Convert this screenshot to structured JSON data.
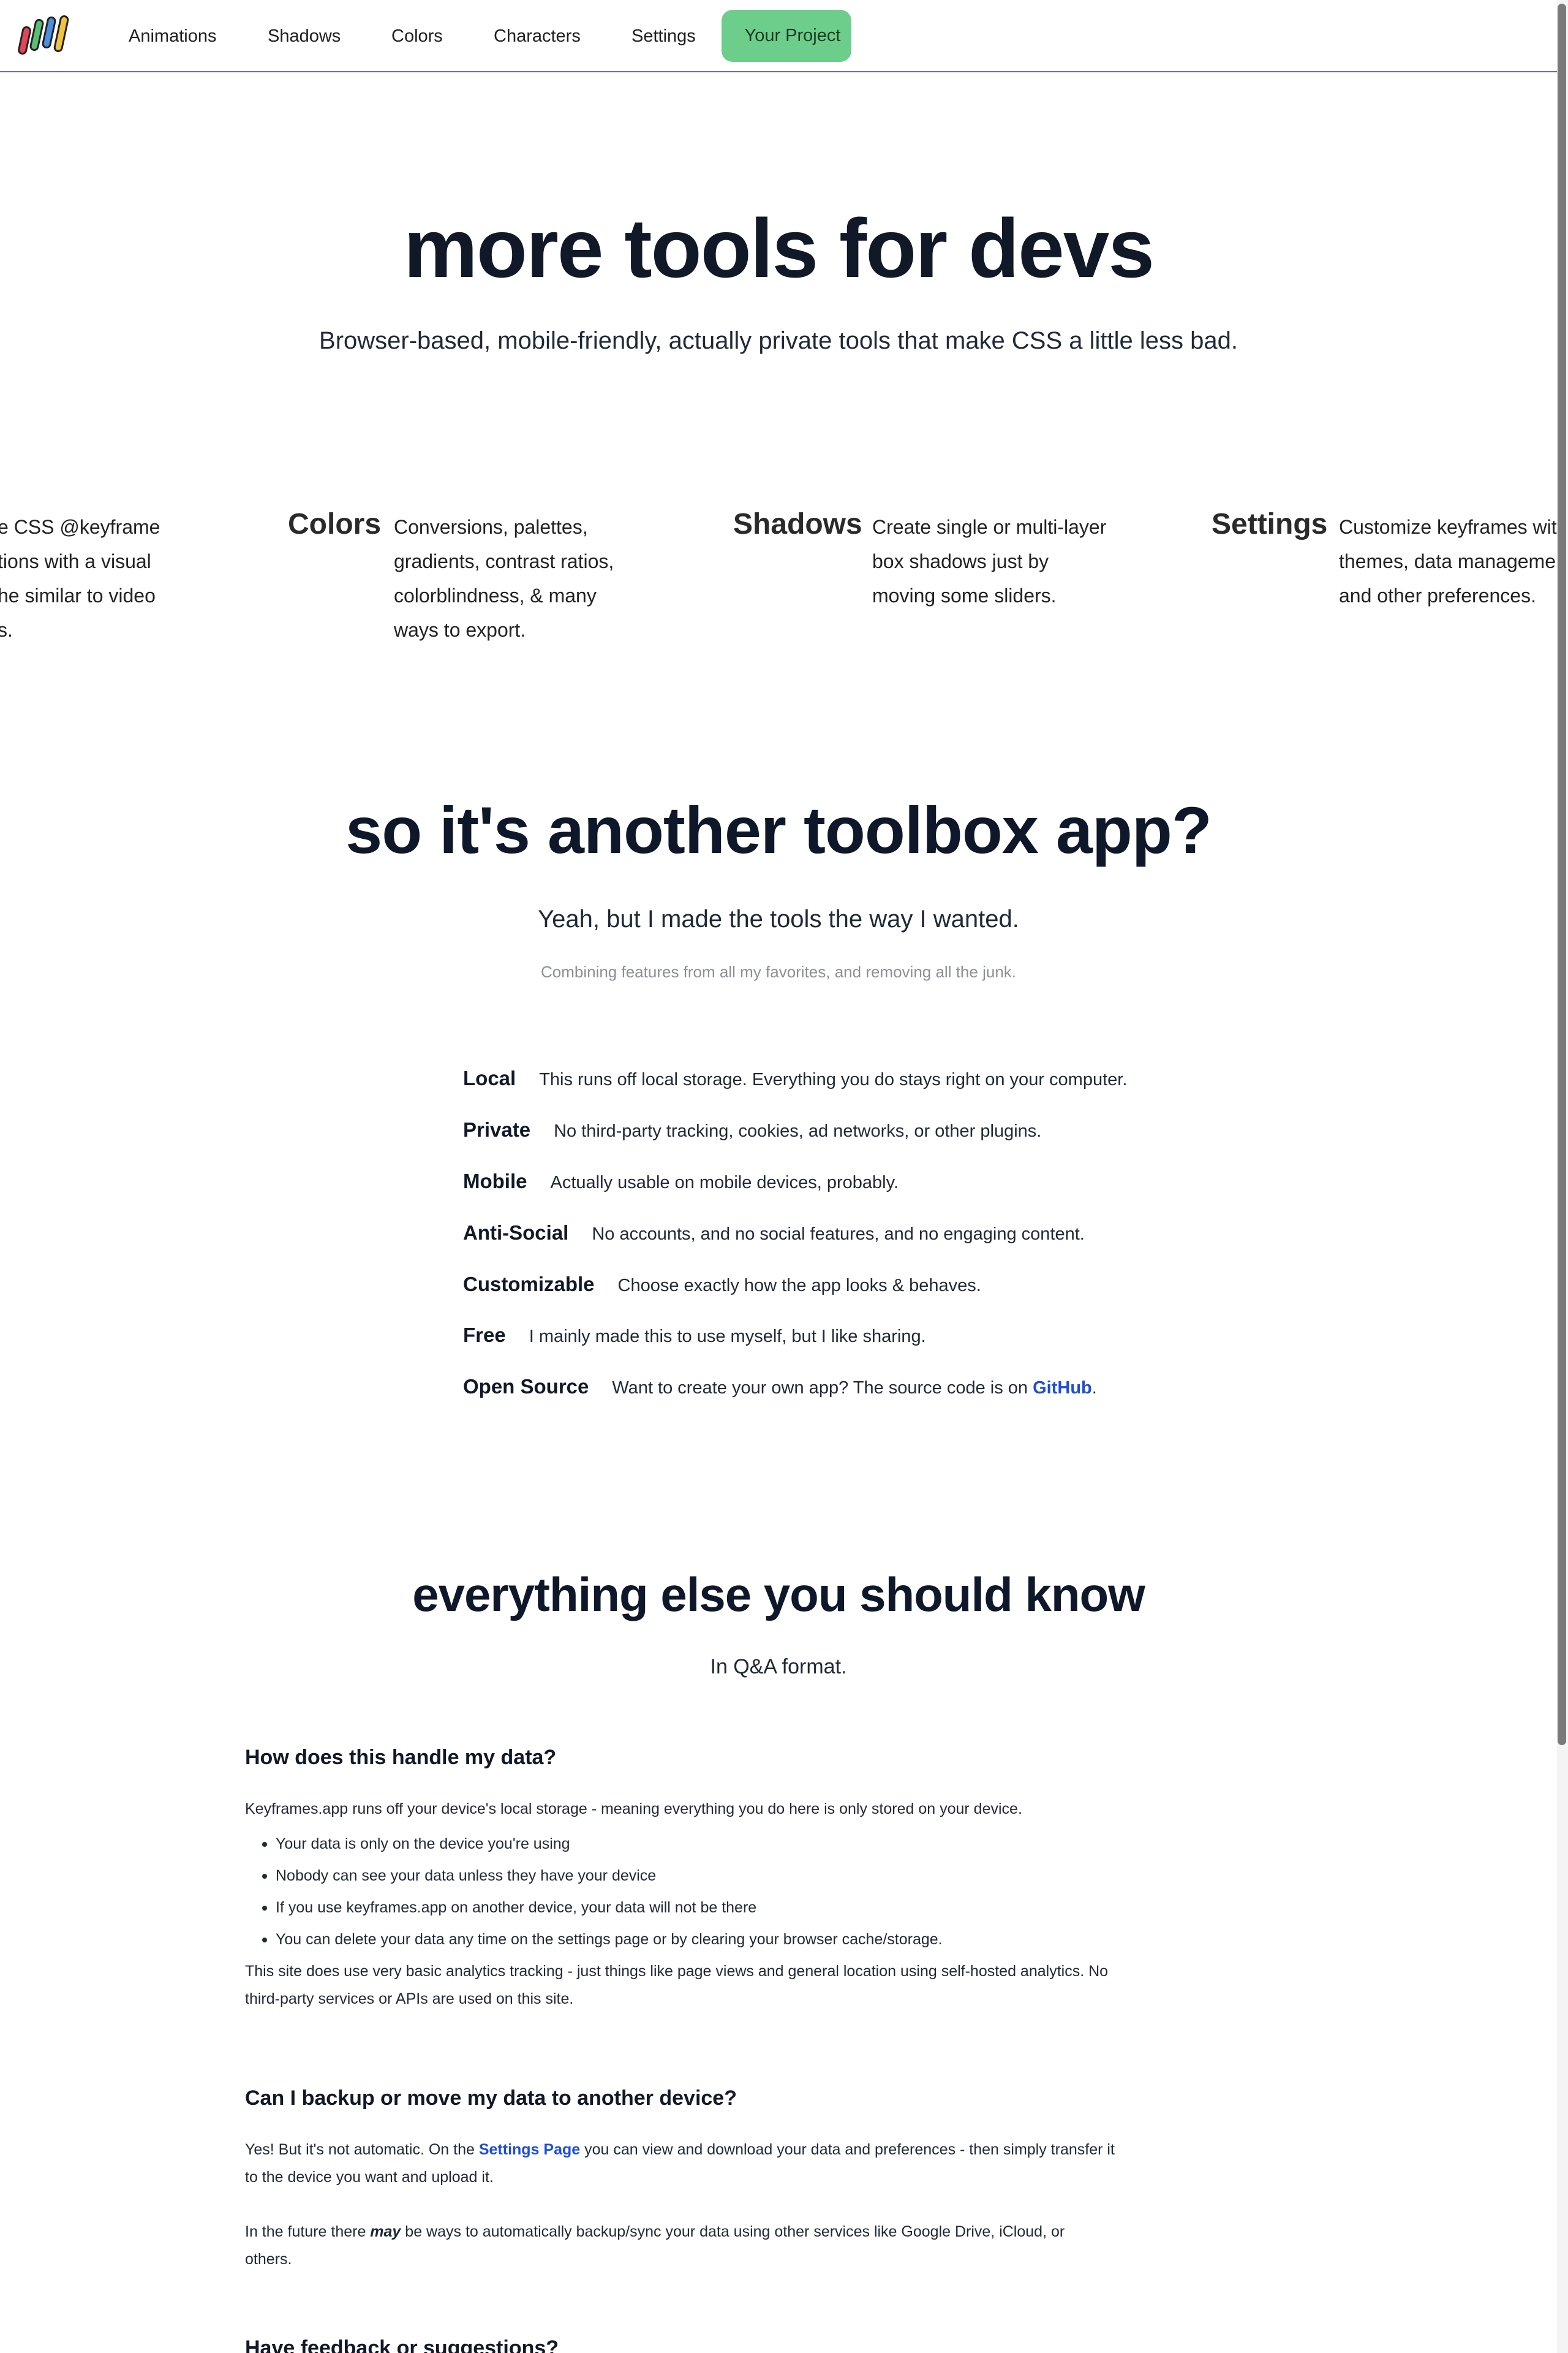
{
  "nav": {
    "logo_alt": "keyframes.app logo",
    "items": [
      "Animations",
      "Shadows",
      "Colors",
      "Characters",
      "Settings"
    ],
    "project_button": "Your Project",
    "project_color": "#6dcd8b"
  },
  "hero": {
    "title": "more tools for devs",
    "subtitle": "Browser-based, mobile-friendly, actually private tools that make CSS a little less bad."
  },
  "carousel": {
    "partial": {
      "desc_lines": [
        "e CSS @keyframe",
        "tions with a visual",
        "he similar to video",
        "s."
      ]
    },
    "items": [
      {
        "name": "Colors",
        "desc_lines": [
          "Conversions, palettes,",
          "gradients, contrast ratios,",
          "colorblindness, & many",
          "ways to export."
        ]
      },
      {
        "name": "Shadows",
        "desc_lines": [
          "Create single or multi-layer",
          "box shadows just by",
          "moving some sliders."
        ]
      },
      {
        "name": "Settings",
        "desc_lines": [
          "Customize keyframes with",
          "themes, data managemen",
          "and other preferences."
        ]
      }
    ]
  },
  "toolbox": {
    "title": "so it's another toolbox app?",
    "subtitle": "Yeah, but I made the tools the way I wanted.",
    "note": "Combining features from all my favorites, and removing all the junk.",
    "features": [
      {
        "label": "Local",
        "text": "This runs off local storage. Everything you do stays right on your computer."
      },
      {
        "label": "Private",
        "text": "No third-party tracking, cookies, ad networks, or other plugins."
      },
      {
        "label": "Mobile",
        "text": "Actually usable on mobile devices, probably."
      },
      {
        "label": "Anti-Social",
        "text": "No accounts, and no social features, and no engaging content."
      },
      {
        "label": "Customizable",
        "text": "Choose exactly how the app looks & behaves."
      },
      {
        "label": "Free",
        "text": "I mainly made this to use myself, but I like sharing."
      }
    ],
    "open_source": {
      "label": "Open Source",
      "text_before": "Want to create your own app? The source code is on ",
      "link": "GitHub",
      "text_after": "."
    }
  },
  "faq": {
    "title": "everything else you should know",
    "subtitle": "In Q&A format.",
    "q1": {
      "question": "How does this handle my data?",
      "intro": "Keyframes.app runs off your device's local storage - meaning everything you do here is only stored on your device.",
      "bullets": [
        "Your data is only on the device you're using",
        "Nobody can see your data unless they have your device",
        "If you use keyframes.app on another device, your data will not be there",
        "You can delete your data any time on the settings page or by clearing your browser cache/storage."
      ],
      "analytics": "This site does use very basic analytics tracking - just things like page views and general location using self-hosted analytics. No third-party services or APIs are used on this site."
    },
    "q2": {
      "question": "Can I backup or move my data to another device?",
      "p1_before": "Yes! But it's not automatic. On the ",
      "p1_link": "Settings Page",
      "p1_after": " you can view and download your data and preferences - then simply transfer it to the device you want and upload it.",
      "p2_before": "In the future there ",
      "p2_em": "may",
      "p2_after": " be ways to automatically backup/sync your data using other services like Google Drive, iCloud, or others."
    },
    "q3": {
      "question": "Have feedback or suggestions?"
    }
  }
}
